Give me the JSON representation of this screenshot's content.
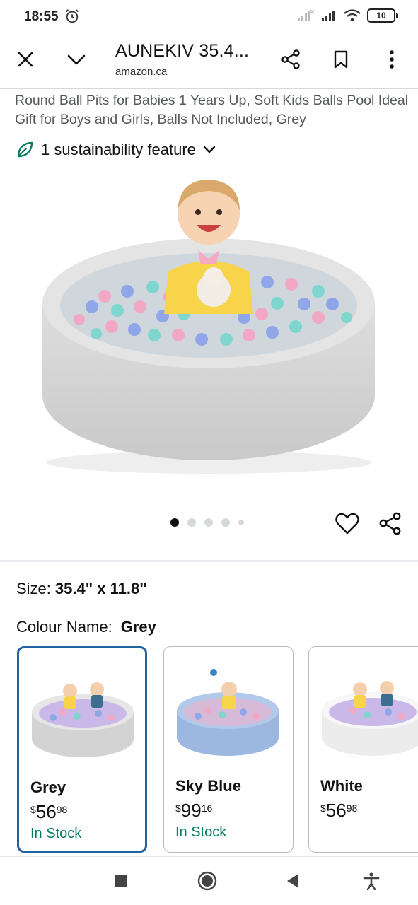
{
  "status_bar": {
    "time": "18:55",
    "battery": "10"
  },
  "app_bar": {
    "title": "AUNEKIV 35.4...",
    "domain": "amazon.ca"
  },
  "product": {
    "title": "Round Ball Pits for Babies 1 Years Up, Soft Kids Balls Pool Ideal Gift for Boys and Girls, Balls Not Included, Grey",
    "sustainability": "1 sustainability feature"
  },
  "carousel": {
    "image_count": 5,
    "active_index": 0
  },
  "options": {
    "size_label": "Size:",
    "size_value": "35.4\" x 11.8\"",
    "colour_label": "Colour Name:",
    "colour_value": "Grey"
  },
  "variants": [
    {
      "name": "Grey",
      "currency": "$",
      "whole": "56",
      "fraction": "98",
      "stock": "In Stock",
      "color": "#d8d8d8",
      "selected": true
    },
    {
      "name": "Sky Blue",
      "currency": "$",
      "whole": "99",
      "fraction": "16",
      "stock": "In Stock",
      "color": "#a9c1e3",
      "selected": false
    },
    {
      "name": "White",
      "currency": "$",
      "whole": "56",
      "fraction": "98",
      "stock": "",
      "color": "#f3f3f3",
      "selected": false
    }
  ],
  "colors": {
    "selected_border": "#2162a1",
    "in_stock": "#067d62",
    "sustain_leaf": "#067d62"
  }
}
